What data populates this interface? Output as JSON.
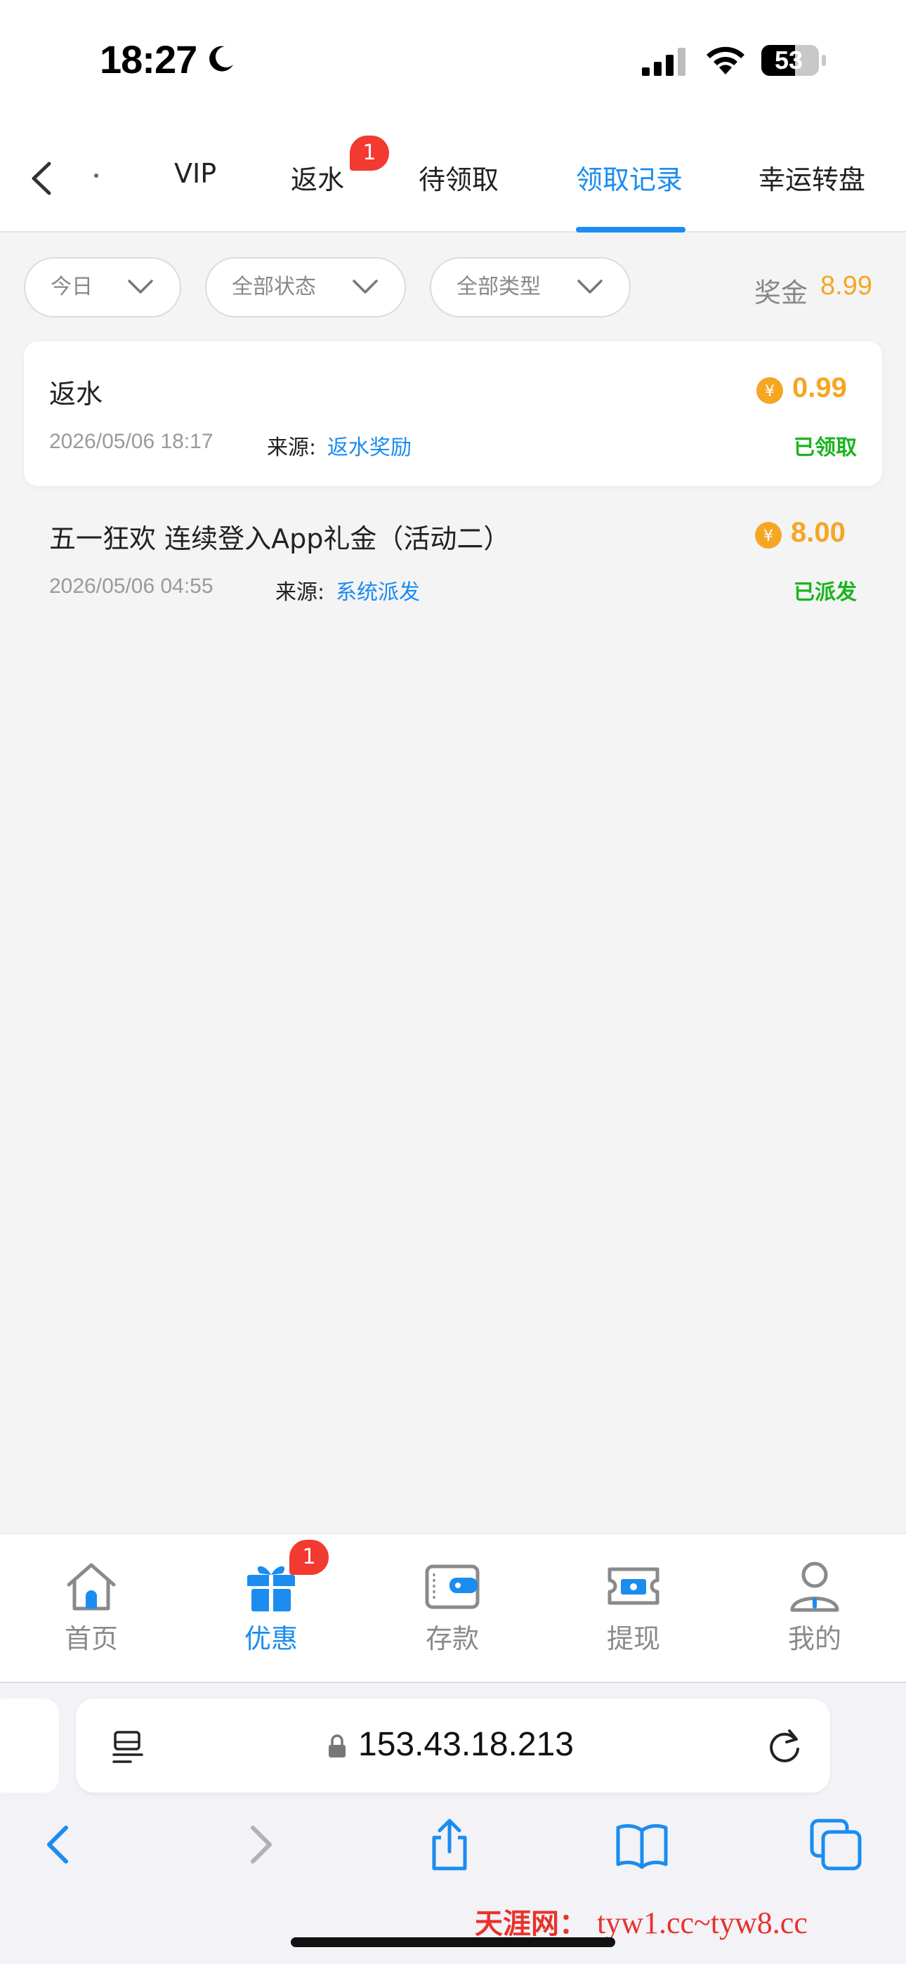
{
  "status_bar": {
    "time": "18:27",
    "battery": "53"
  },
  "tabs": {
    "items": [
      {
        "label": "VIP"
      },
      {
        "label": "返水",
        "badge": "1"
      },
      {
        "label": "待领取"
      },
      {
        "label": "领取记录",
        "active": true
      },
      {
        "label": "幸运转盘"
      }
    ]
  },
  "filters": {
    "date": "今日",
    "status": "全部状态",
    "type": "全部类型",
    "bonus_label": "奖金",
    "bonus_value": "8.99"
  },
  "records": [
    {
      "title": "返水",
      "date": "2026/05/06 18:17",
      "source_label": "来源:",
      "source": "返水奖励",
      "amount": "0.99",
      "status": "已领取"
    },
    {
      "title": "五一狂欢 连续登入App礼金（活动二）",
      "date": "2026/05/06 04:55",
      "source_label": "来源:",
      "source": "系统派发",
      "amount": "8.00",
      "status": "已派发"
    }
  ],
  "bottom_nav": {
    "items": [
      {
        "label": "首页"
      },
      {
        "label": "优惠",
        "active": true,
        "badge": "1"
      },
      {
        "label": "存款"
      },
      {
        "label": "提现"
      },
      {
        "label": "我的"
      }
    ]
  },
  "browser": {
    "url": "153.43.18.213"
  },
  "watermark": {
    "brand": "天涯网：",
    "url": "tyw1.cc~tyw8.cc"
  },
  "colors": {
    "accent": "#1b8cf0",
    "bonus": "#f5a623",
    "success": "#19b51e",
    "badge": "#f23a31"
  }
}
